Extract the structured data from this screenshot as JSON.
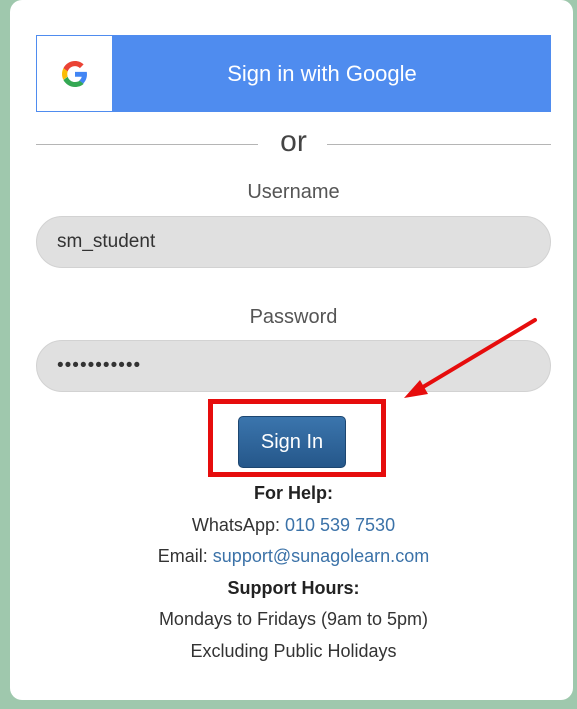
{
  "google_button": {
    "label": "Sign in with Google",
    "icon": "google-g-icon"
  },
  "divider": {
    "text": "or"
  },
  "username": {
    "label": "Username",
    "value": "sm_student"
  },
  "password": {
    "label": "Password",
    "value": "•••••••••••"
  },
  "signin_button": {
    "label": "Sign In"
  },
  "help": {
    "heading": "For Help:",
    "whatsapp_label": "WhatsApp: ",
    "whatsapp_number": "010 539 7530",
    "email_label": "Email: ",
    "email": "support@sunagolearn.com",
    "hours_heading": "Support Hours:",
    "hours": "Mondays to Fridays (9am to 5pm)",
    "exclusion": "Excluding Public Holidays"
  },
  "annotation": {
    "color": "#e60d0d"
  }
}
